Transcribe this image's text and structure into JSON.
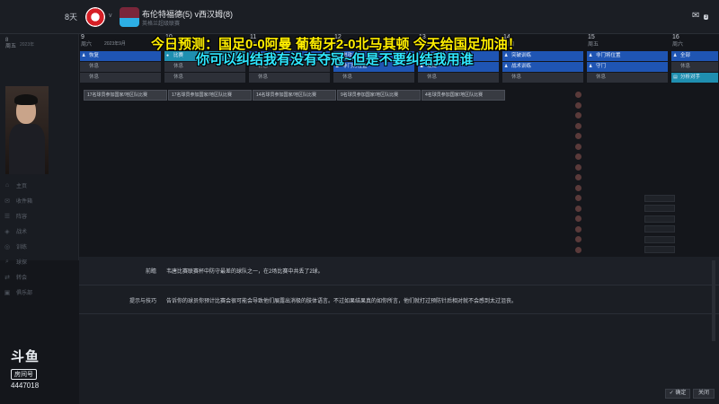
{
  "header": {
    "days_label": "8天",
    "vs_small": "v",
    "match_title": "布伦特福德(5) v西汉姆(8)",
    "competition": "英格兰超级联赛",
    "notification_count": "3"
  },
  "overlay": {
    "line1": "今日预测：国足0-0阿曼 葡萄牙2-0北马其顿 今天给国足加油！",
    "line2": "你可以纠结我有没有夺冠~但是不要纠结我用谁"
  },
  "left": {
    "day_num": "8",
    "weekday": "周五",
    "year": "2023年",
    "menu": [
      {
        "icon": "home-icon",
        "glyph": "⌂",
        "label": "主页"
      },
      {
        "icon": "inbox-icon",
        "glyph": "✉",
        "label": "收件箱"
      },
      {
        "icon": "squad-icon",
        "glyph": "☰",
        "label": "阵容"
      },
      {
        "icon": "tactics-icon",
        "glyph": "◈",
        "label": "战术"
      },
      {
        "icon": "training-icon",
        "glyph": "◎",
        "label": "训练"
      },
      {
        "icon": "scouting-icon",
        "glyph": "⌕",
        "label": "球探"
      },
      {
        "icon": "transfers-icon",
        "glyph": "⇄",
        "label": "转会"
      },
      {
        "icon": "club-icon",
        "glyph": "▣",
        "label": "俱乐部"
      }
    ]
  },
  "calendar": {
    "month": "2023年9月",
    "columns": [
      {
        "num": "9",
        "day": "周六",
        "slots": [
          {
            "type": "train",
            "label": "恢复"
          },
          {
            "type": "rest",
            "label": "休息"
          },
          {
            "type": "rest",
            "label": "休息"
          }
        ]
      },
      {
        "num": "10",
        "day": "周日",
        "slots": [
          {
            "type": "teal",
            "label": "比赛"
          },
          {
            "type": "rest",
            "label": "休息"
          },
          {
            "type": "rest",
            "label": "休息"
          }
        ]
      },
      {
        "num": "11",
        "day": "周一",
        "slots": [
          {
            "type": "train",
            "label": "恢复"
          },
          {
            "type": "rest",
            "label": "休息"
          },
          {
            "type": "rest",
            "label": "休息"
          }
        ]
      },
      {
        "num": "12",
        "day": "周二",
        "slots": [
          {
            "type": "train",
            "label": "进攻"
          },
          {
            "type": "train",
            "label": "非门将位置"
          },
          {
            "type": "rest",
            "label": "休息"
          }
        ]
      },
      {
        "num": "13",
        "day": "周三",
        "slots": [
          {
            "type": "train",
            "label": "恢复"
          },
          {
            "type": "train",
            "label": "攻击"
          },
          {
            "type": "rest",
            "label": "休息"
          }
        ]
      },
      {
        "num": "14",
        "day": "周四",
        "slots": [
          {
            "type": "train",
            "label": "突破训练"
          },
          {
            "type": "train",
            "label": "战术训练"
          },
          {
            "type": "rest",
            "label": "休息"
          }
        ]
      },
      {
        "num": "15",
        "day": "周五",
        "slots": [
          {
            "type": "train",
            "label": "非门将位置"
          },
          {
            "type": "train",
            "label": "守门"
          },
          {
            "type": "rest",
            "label": "休息"
          }
        ]
      },
      {
        "num": "16",
        "day": "周六",
        "slots": [
          {
            "type": "train",
            "label": "全部"
          },
          {
            "type": "rest",
            "label": "休息"
          },
          {
            "type": "teal",
            "label": "分析对手"
          }
        ]
      }
    ],
    "competitions": [
      "17名球员参加国家/地区队比赛",
      "17名球员参加国家/地区队比赛",
      "14名球员参加国家/地区队比赛",
      "9名球员参加国家/地区队比赛",
      "4名球员参加国家/地区队比赛"
    ]
  },
  "bottom": {
    "preview_label": "前瞻",
    "preview_text": "韦唐比赛联赛杯中防守最差的球队之一，在2场比赛中共丢了2球。",
    "tips_label": "提示与技巧",
    "tips_text": "告诉你的球员你预计比赛会很可能会导致他们展露出消极的肢体语言。不过如果结果真的如你所言，他们就打过预防针后相对就不会感到太过沮丧。"
  },
  "footer": {
    "brand": "斗鱼",
    "badge": "房间号",
    "room": "4447018",
    "confirm": "确定",
    "close": "关闭"
  }
}
